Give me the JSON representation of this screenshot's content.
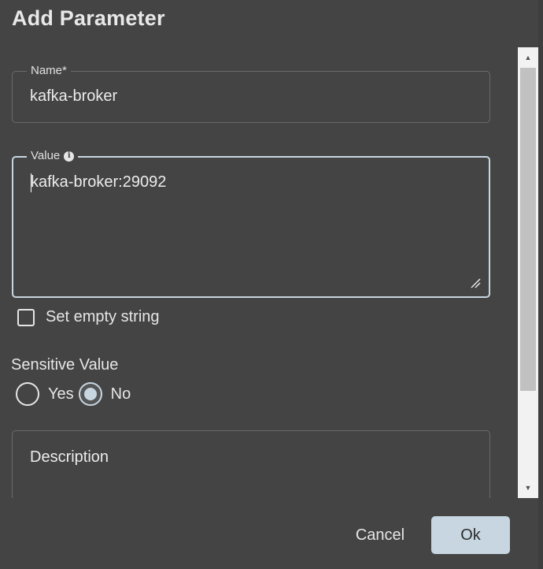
{
  "dialog": {
    "title": "Add Parameter"
  },
  "name_field": {
    "label": "Name*",
    "value": "kafka-broker"
  },
  "value_field": {
    "label": "Value",
    "value": "kafka-broker:29092"
  },
  "empty_string_checkbox": {
    "label": "Set empty string",
    "checked": false
  },
  "sensitive": {
    "label": "Sensitive Value",
    "options": [
      {
        "label": "Yes",
        "selected": false
      },
      {
        "label": "No",
        "selected": true
      }
    ]
  },
  "description_field": {
    "label": "Description"
  },
  "footer": {
    "cancel_label": "Cancel",
    "ok_label": "Ok"
  },
  "colors": {
    "background": "#444444",
    "accent": "#c7d6e0",
    "scrollbar_track": "#f2f2f2",
    "scrollbar_thumb": "#c1c1c1"
  },
  "icons": {
    "value_info": "info-icon",
    "scroll_up": "scroll-up-arrow-icon",
    "scroll_down": "scroll-down-arrow-icon",
    "resize": "resize-handle-icon"
  }
}
